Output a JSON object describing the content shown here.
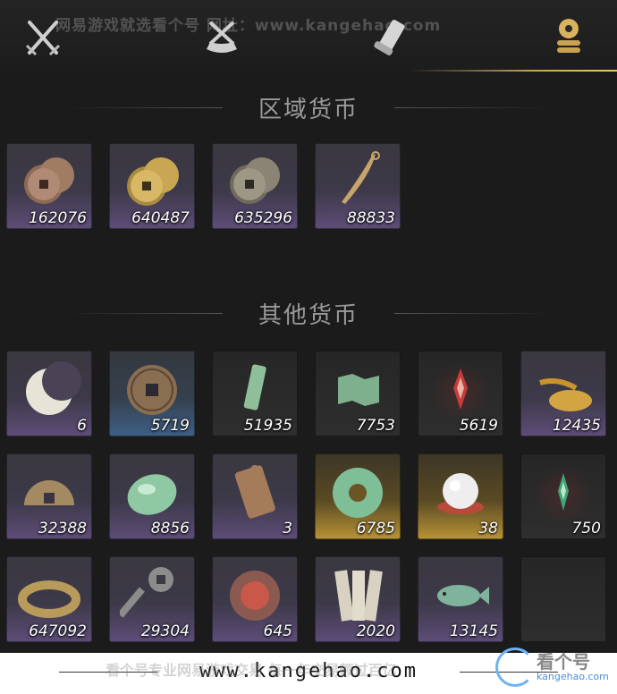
{
  "watermark_top": "网易游戏就选看个号  网址：www.kangehao.com",
  "tabs": [
    {
      "icon": "crossed-swords-icon"
    },
    {
      "icon": "bundle-icon"
    },
    {
      "icon": "scroll-icon"
    },
    {
      "icon": "currency-coins-icon",
      "active": true
    }
  ],
  "regional": {
    "title": "区域货币",
    "items": [
      {
        "icon": "copper-coins-icon",
        "count": "162076"
      },
      {
        "icon": "gold-coins-icon",
        "count": "640487"
      },
      {
        "icon": "silver-coins-icon",
        "count": "635296"
      },
      {
        "icon": "feather-blade-icon",
        "count": "88833"
      }
    ]
  },
  "other": {
    "title": "其他货币",
    "items": [
      {
        "icon": "jade-crescent-icon",
        "count": "6",
        "style": "purple"
      },
      {
        "icon": "ancient-coin-icon",
        "count": "5719",
        "style": "blue"
      },
      {
        "icon": "token-tablet-icon",
        "count": "51935",
        "style": "dark"
      },
      {
        "icon": "map-fragment-icon",
        "count": "7753",
        "style": "dark"
      },
      {
        "icon": "red-sigil-icon",
        "count": "5619",
        "style": "dark"
      },
      {
        "icon": "wheat-grain-icon",
        "count": "12435",
        "style": "purple"
      },
      {
        "icon": "half-coin-icon",
        "count": "32388",
        "style": "purple"
      },
      {
        "icon": "jade-stone-icon",
        "count": "8856",
        "style": "purple"
      },
      {
        "icon": "bronze-plaque-icon",
        "count": "3",
        "style": "purple"
      },
      {
        "icon": "jade-disc-icon",
        "count": "6785",
        "style": "gold"
      },
      {
        "icon": "pearl-icon",
        "count": "38",
        "style": "gold"
      },
      {
        "icon": "green-sigil-icon",
        "count": "750",
        "style": "dark"
      },
      {
        "icon": "coin-string-icon",
        "count": "647092",
        "style": "purple"
      },
      {
        "icon": "key-coin-icon",
        "count": "29304",
        "style": "purple"
      },
      {
        "icon": "red-seal-icon",
        "count": "645",
        "style": "purple"
      },
      {
        "icon": "paper-slips-icon",
        "count": "2020",
        "style": "purple"
      },
      {
        "icon": "jade-fish-icon",
        "count": "13145",
        "style": "purple"
      }
    ]
  },
  "footer": {
    "url": "www.kangehao.com",
    "watermark": "看个号专业网易游戏交易  每一年交易额过百亿",
    "badge_title": "看个号",
    "badge_sub": "kangehao.com"
  }
}
